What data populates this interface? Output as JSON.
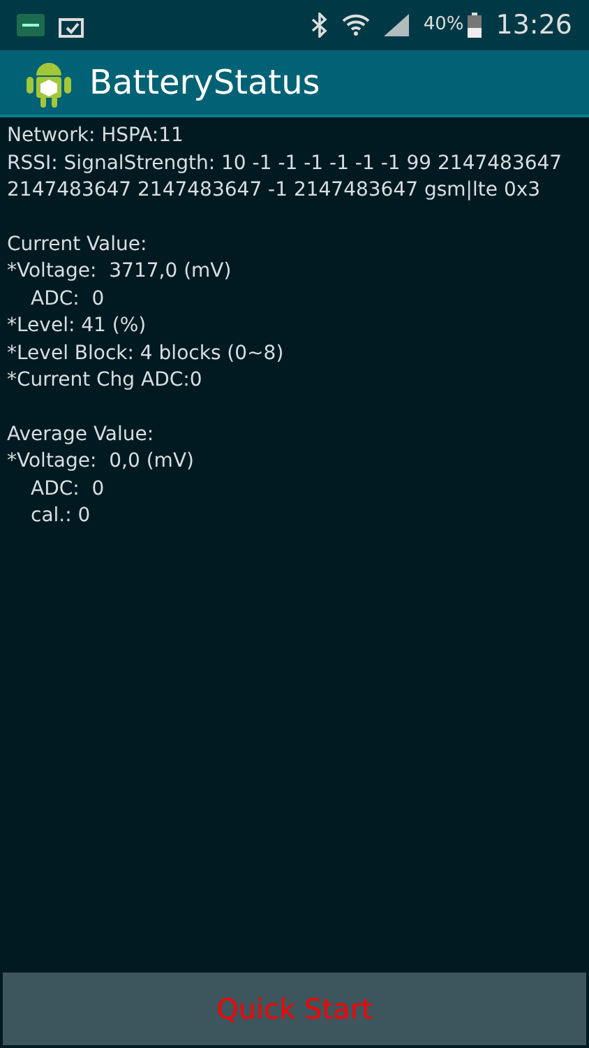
{
  "status_bar": {
    "battery_text": "40%",
    "time": "13:26"
  },
  "app_bar": {
    "title": "BatteryStatus"
  },
  "sections": [
    {
      "lines": [
        {
          "text": "Network: HSPA:11",
          "indented": false
        },
        {
          "text": "RSSI: SignalStrength: 10 -1 -1 -1 -1 -1 -1 99 2147483647 2147483647 2147483647 -1 2147483647 gsm|lte 0x3",
          "indented": false
        }
      ]
    },
    {
      "lines": [
        {
          "text": "Current Value:",
          "indented": false
        },
        {
          "text": "*Voltage:  3717,0 (mV)",
          "indented": false
        },
        {
          "text": "ADC:  0",
          "indented": true
        },
        {
          "text": "*Level: 41 (%)",
          "indented": false
        },
        {
          "text": "*Level Block: 4 blocks (0~8)",
          "indented": false
        },
        {
          "text": "*Current Chg ADC:0",
          "indented": false
        }
      ]
    },
    {
      "lines": [
        {
          "text": "Average Value:",
          "indented": false
        },
        {
          "text": "*Voltage:  0,0 (mV)",
          "indented": false
        },
        {
          "text": "ADC:  0",
          "indented": true
        },
        {
          "text": "cal.: 0",
          "indented": true
        }
      ]
    }
  ],
  "button": {
    "label": "Quick Start"
  }
}
